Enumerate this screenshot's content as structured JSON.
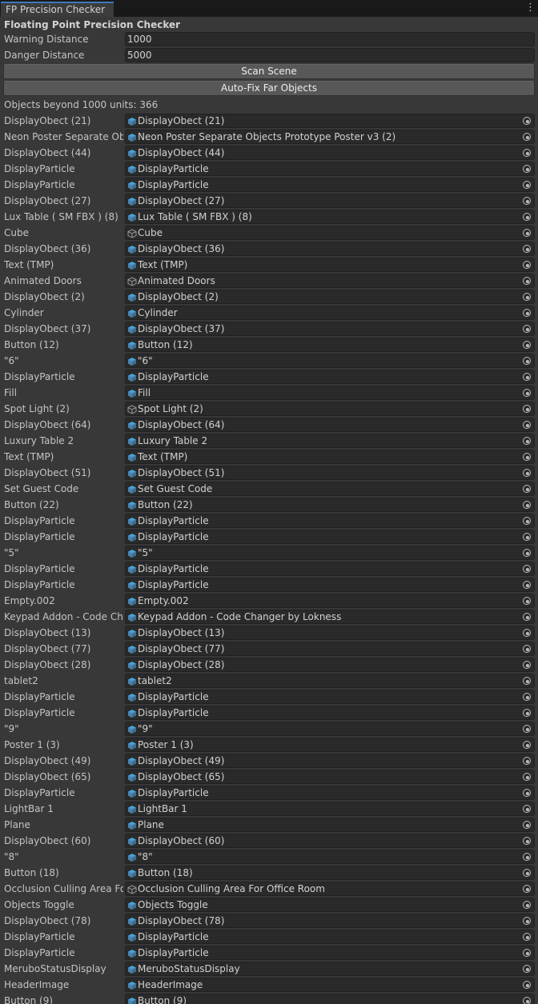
{
  "window": {
    "tab_title": "FP Precision Checker",
    "menu_icon": "kebab-menu-icon"
  },
  "header": {
    "title": "Floating Point Precision Checker"
  },
  "settings": {
    "warning_label": "Warning Distance",
    "warning_value": "1000",
    "danger_label": "Danger Distance",
    "danger_value": "5000"
  },
  "actions": {
    "scan_label": "Scan Scene",
    "autofix_label": "Auto-Fix Far Objects"
  },
  "results": {
    "count_text": "Objects beyond 1000 units: 366",
    "icon_colors": {
      "prefab": "#4fa3e0",
      "gameobject": "#9a9a9a"
    },
    "items": [
      {
        "label": "DisplayObect (21)",
        "value": "DisplayObect (21)",
        "icon": "prefab"
      },
      {
        "label": "Neon Poster Separate Objects Prototype Poster v3 (2)",
        "value": "Neon Poster Separate Objects Prototype Poster v3 (2)",
        "icon": "prefab"
      },
      {
        "label": "DisplayObect (44)",
        "value": "DisplayObect (44)",
        "icon": "prefab"
      },
      {
        "label": "DisplayParticle",
        "value": "DisplayParticle",
        "icon": "prefab"
      },
      {
        "label": "DisplayParticle",
        "value": "DisplayParticle",
        "icon": "prefab"
      },
      {
        "label": "DisplayObect (27)",
        "value": "DisplayObect (27)",
        "icon": "prefab"
      },
      {
        "label": "Lux Table ( SM FBX ) (8)",
        "value": "Lux Table ( SM FBX ) (8)",
        "icon": "prefab"
      },
      {
        "label": "Cube",
        "value": "Cube",
        "icon": "gameobject"
      },
      {
        "label": "DisplayObect (36)",
        "value": "DisplayObect (36)",
        "icon": "prefab"
      },
      {
        "label": "Text (TMP)",
        "value": "Text (TMP)",
        "icon": "prefab"
      },
      {
        "label": "Animated Doors",
        "value": "Animated Doors",
        "icon": "gameobject"
      },
      {
        "label": "DisplayObect (2)",
        "value": "DisplayObect (2)",
        "icon": "prefab"
      },
      {
        "label": "Cylinder",
        "value": "Cylinder",
        "icon": "prefab"
      },
      {
        "label": "DisplayObect (37)",
        "value": "DisplayObect (37)",
        "icon": "prefab"
      },
      {
        "label": "Button (12)",
        "value": "Button (12)",
        "icon": "prefab"
      },
      {
        "label": "\"6\"",
        "value": "\"6\"",
        "icon": "prefab"
      },
      {
        "label": "DisplayParticle",
        "value": "DisplayParticle",
        "icon": "prefab"
      },
      {
        "label": "Fill",
        "value": "Fill",
        "icon": "prefab"
      },
      {
        "label": "Spot Light (2)",
        "value": "Spot Light (2)",
        "icon": "gameobject"
      },
      {
        "label": "DisplayObect (64)",
        "value": "DisplayObect (64)",
        "icon": "prefab"
      },
      {
        "label": "Luxury Table  2",
        "value": "Luxury Table  2",
        "icon": "prefab"
      },
      {
        "label": "Text (TMP)",
        "value": "Text (TMP)",
        "icon": "prefab"
      },
      {
        "label": "DisplayObect (51)",
        "value": "DisplayObect (51)",
        "icon": "prefab"
      },
      {
        "label": "Set Guest Code",
        "value": "Set Guest Code",
        "icon": "prefab"
      },
      {
        "label": "Button (22)",
        "value": "Button (22)",
        "icon": "prefab"
      },
      {
        "label": "DisplayParticle",
        "value": "DisplayParticle",
        "icon": "prefab"
      },
      {
        "label": "DisplayParticle",
        "value": "DisplayParticle",
        "icon": "prefab"
      },
      {
        "label": "\"5\"",
        "value": "\"5\"",
        "icon": "prefab"
      },
      {
        "label": "DisplayParticle",
        "value": "DisplayParticle",
        "icon": "prefab"
      },
      {
        "label": "DisplayParticle",
        "value": "DisplayParticle",
        "icon": "prefab"
      },
      {
        "label": "Empty.002",
        "value": "Empty.002",
        "icon": "prefab"
      },
      {
        "label": "Keypad Addon - Code Changer by Lokness",
        "value": "Keypad Addon - Code Changer by Lokness",
        "icon": "prefab"
      },
      {
        "label": "DisplayObect (13)",
        "value": "DisplayObect (13)",
        "icon": "prefab"
      },
      {
        "label": "DisplayObect (77)",
        "value": "DisplayObect (77)",
        "icon": "prefab"
      },
      {
        "label": "DisplayObect (28)",
        "value": "DisplayObect (28)",
        "icon": "prefab"
      },
      {
        "label": "tablet2",
        "value": "tablet2",
        "icon": "prefab"
      },
      {
        "label": "DisplayParticle",
        "value": "DisplayParticle",
        "icon": "prefab"
      },
      {
        "label": "DisplayParticle",
        "value": "DisplayParticle",
        "icon": "prefab"
      },
      {
        "label": "\"9\"",
        "value": "\"9\"",
        "icon": "prefab"
      },
      {
        "label": "Poster 1 (3)",
        "value": "Poster 1 (3)",
        "icon": "prefab"
      },
      {
        "label": "DisplayObect (49)",
        "value": "DisplayObect (49)",
        "icon": "prefab"
      },
      {
        "label": "DisplayObect (65)",
        "value": "DisplayObect (65)",
        "icon": "prefab"
      },
      {
        "label": "DisplayParticle",
        "value": "DisplayParticle",
        "icon": "prefab"
      },
      {
        "label": "LightBar 1",
        "value": "LightBar 1",
        "icon": "prefab"
      },
      {
        "label": "Plane",
        "value": "Plane",
        "icon": "prefab"
      },
      {
        "label": "DisplayObect (60)",
        "value": "DisplayObect (60)",
        "icon": "prefab"
      },
      {
        "label": "\"8\"",
        "value": "\"8\"",
        "icon": "prefab"
      },
      {
        "label": "Button (18)",
        "value": "Button (18)",
        "icon": "prefab"
      },
      {
        "label": "Occlusion Culling Area For Office Room",
        "value": "Occlusion Culling Area For Office Room",
        "icon": "gameobject"
      },
      {
        "label": "Objects Toggle",
        "value": "Objects Toggle",
        "icon": "prefab"
      },
      {
        "label": "DisplayObect (78)",
        "value": "DisplayObect (78)",
        "icon": "prefab"
      },
      {
        "label": "DisplayParticle",
        "value": "DisplayParticle",
        "icon": "prefab"
      },
      {
        "label": "DisplayParticle",
        "value": "DisplayParticle",
        "icon": "prefab"
      },
      {
        "label": "MeruboStatusDisplay",
        "value": "MeruboStatusDisplay",
        "icon": "prefab"
      },
      {
        "label": "HeaderImage",
        "value": "HeaderImage",
        "icon": "prefab"
      },
      {
        "label": "Button (9)",
        "value": "Button (9)",
        "icon": "prefab"
      }
    ]
  }
}
